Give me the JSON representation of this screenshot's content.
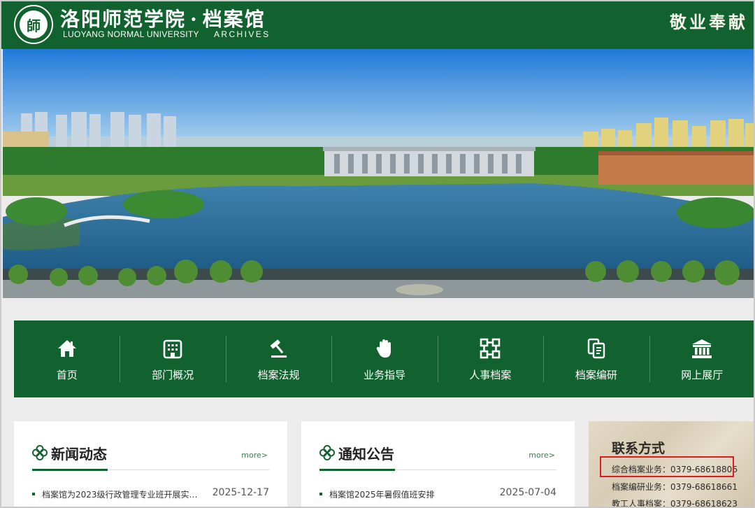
{
  "header": {
    "title_cn_part1": "洛阳师范学院",
    "title_sep": "·",
    "title_cn_part2": "档案馆",
    "title_en_university": "LUOYANG NORMAL UNIVERSITY",
    "title_en_archives": "ARCHIVES",
    "motto": "敬业奉献",
    "seal_glyph": "師"
  },
  "nav": {
    "items": [
      {
        "label": "首页",
        "icon": "home-icon"
      },
      {
        "label": "部门概况",
        "icon": "building-icon"
      },
      {
        "label": "档案法规",
        "icon": "gavel-icon"
      },
      {
        "label": "业务指导",
        "icon": "hand-icon"
      },
      {
        "label": "人事档案",
        "icon": "org-chart-icon"
      },
      {
        "label": "档案编研",
        "icon": "documents-icon"
      },
      {
        "label": "网上展厅",
        "icon": "museum-icon"
      }
    ]
  },
  "news": {
    "title": "新闻动态",
    "more": "more>",
    "items": [
      {
        "title": "档案馆为2023级行政管理专业班开展实践…",
        "date": "2025-12-17"
      }
    ]
  },
  "notice": {
    "title": "通知公告",
    "more": "more>",
    "items": [
      {
        "title": "档案馆2025年暑假值班安排",
        "date": "2025-07-04"
      }
    ]
  },
  "contact": {
    "title": "联系方式",
    "lines": [
      "综合档案业务：0379-68618806",
      "档案编研业务：0379-68618661",
      "教工人事档案：0379-68618623"
    ]
  },
  "colors": {
    "brand_green": "#12622f",
    "highlight_red": "#e01b1b"
  }
}
